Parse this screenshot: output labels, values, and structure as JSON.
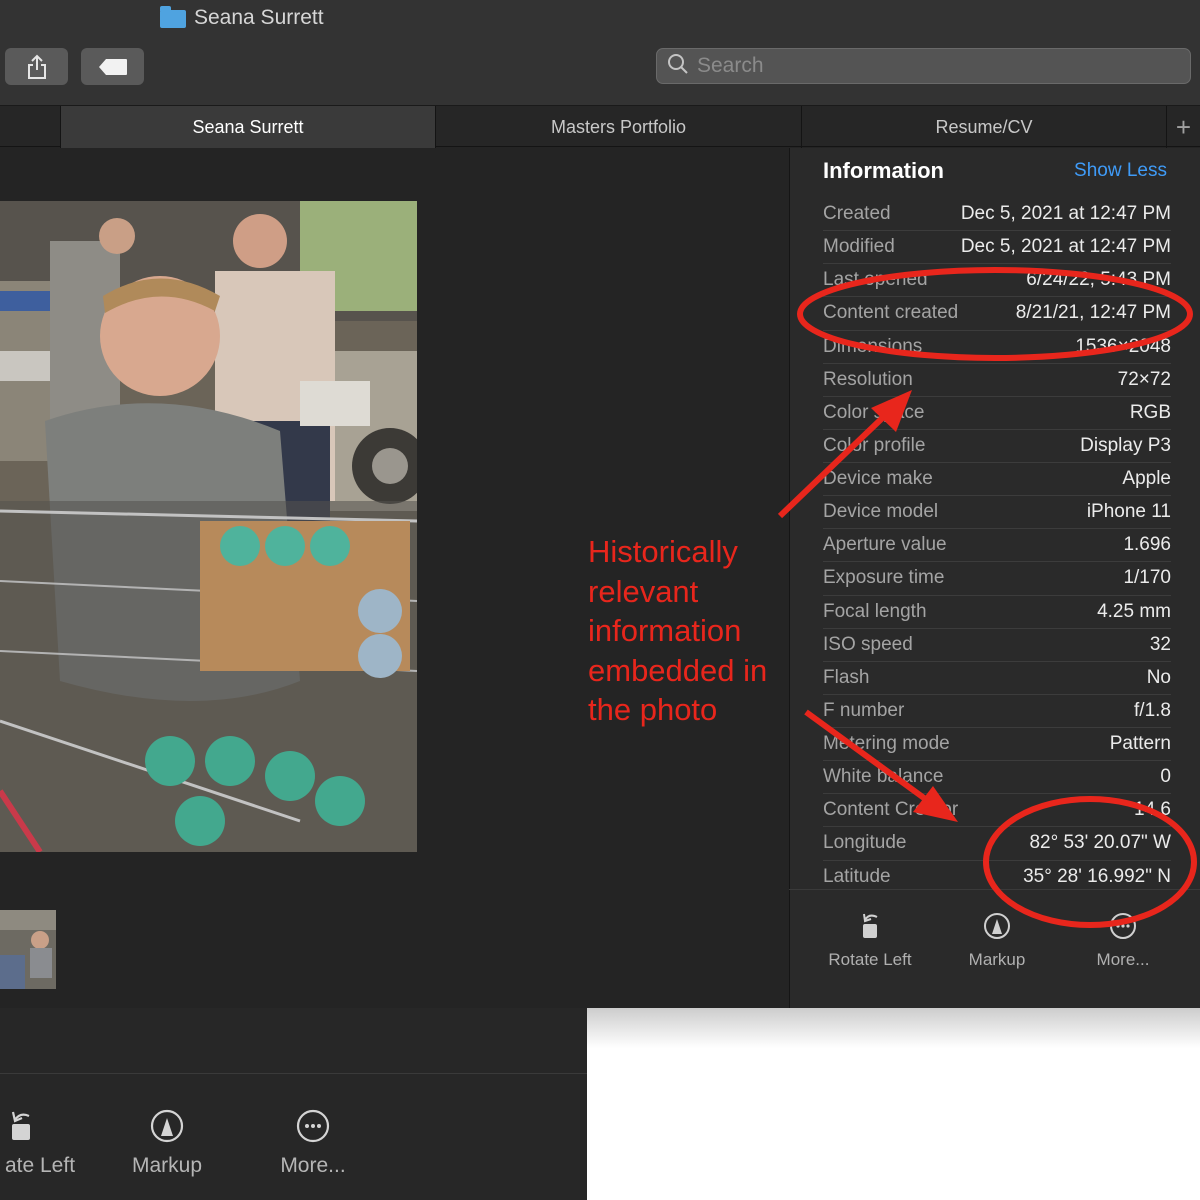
{
  "window": {
    "title": "Seana Surrett"
  },
  "toolbar": {
    "share_icon": "share-icon",
    "tag_icon": "tag-icon",
    "search": {
      "placeholder": "Search",
      "value": ""
    }
  },
  "tabs": [
    {
      "label": "Seana Surrett",
      "active": true
    },
    {
      "label": "Masters Portfolio",
      "active": false
    },
    {
      "label": "Resume/CV",
      "active": false
    }
  ],
  "info": {
    "title": "Information",
    "show_less": "Show Less",
    "rows": [
      {
        "key": "Created",
        "value": "Dec 5, 2021 at 12:47 PM"
      },
      {
        "key": "Modified",
        "value": "Dec 5, 2021 at 12:47 PM"
      },
      {
        "key": "Last opened",
        "value": "6/24/22, 5:43 PM"
      },
      {
        "key": "Content created",
        "value": "8/21/21, 12:47 PM"
      },
      {
        "key": "Dimensions",
        "value": "1536×2048"
      },
      {
        "key": "Resolution",
        "value": "72×72"
      },
      {
        "key": "Color space",
        "value": "RGB"
      },
      {
        "key": "Color profile",
        "value": "Display P3"
      },
      {
        "key": "Device make",
        "value": "Apple"
      },
      {
        "key": "Device model",
        "value": "iPhone 11"
      },
      {
        "key": "Aperture value",
        "value": "1.696"
      },
      {
        "key": "Exposure time",
        "value": "1/170"
      },
      {
        "key": "Focal length",
        "value": "4.25 mm"
      },
      {
        "key": "ISO speed",
        "value": "32"
      },
      {
        "key": "Flash",
        "value": "No"
      },
      {
        "key": "F number",
        "value": "f/1.8"
      },
      {
        "key": "Metering mode",
        "value": "Pattern"
      },
      {
        "key": "White balance",
        "value": "0"
      },
      {
        "key": "Content Creator",
        "value": "14.6"
      },
      {
        "key": "Longitude",
        "value": "82° 53' 20.07\" W"
      },
      {
        "key": "Latitude",
        "value": "35° 28' 16.992\" N"
      }
    ],
    "actions": [
      {
        "label": "Rotate Left",
        "icon": "rotate-left-icon"
      },
      {
        "label": "Markup",
        "icon": "markup-icon"
      },
      {
        "label": "More...",
        "icon": "more-icon"
      }
    ]
  },
  "lower_bar": {
    "actions": [
      {
        "label": "ate Left",
        "icon": "rotate-left-icon"
      },
      {
        "label": "Markup",
        "icon": "markup-icon"
      },
      {
        "label": "More...",
        "icon": "more-icon"
      }
    ]
  },
  "annotation": {
    "text": [
      "Historically",
      "relevant",
      "information",
      "embedded in",
      "the photo"
    ],
    "color": "#e8261c"
  },
  "colors": {
    "accent": "#3f9bf7",
    "annotation_red": "#e8261c",
    "window_bg": "#242424"
  }
}
